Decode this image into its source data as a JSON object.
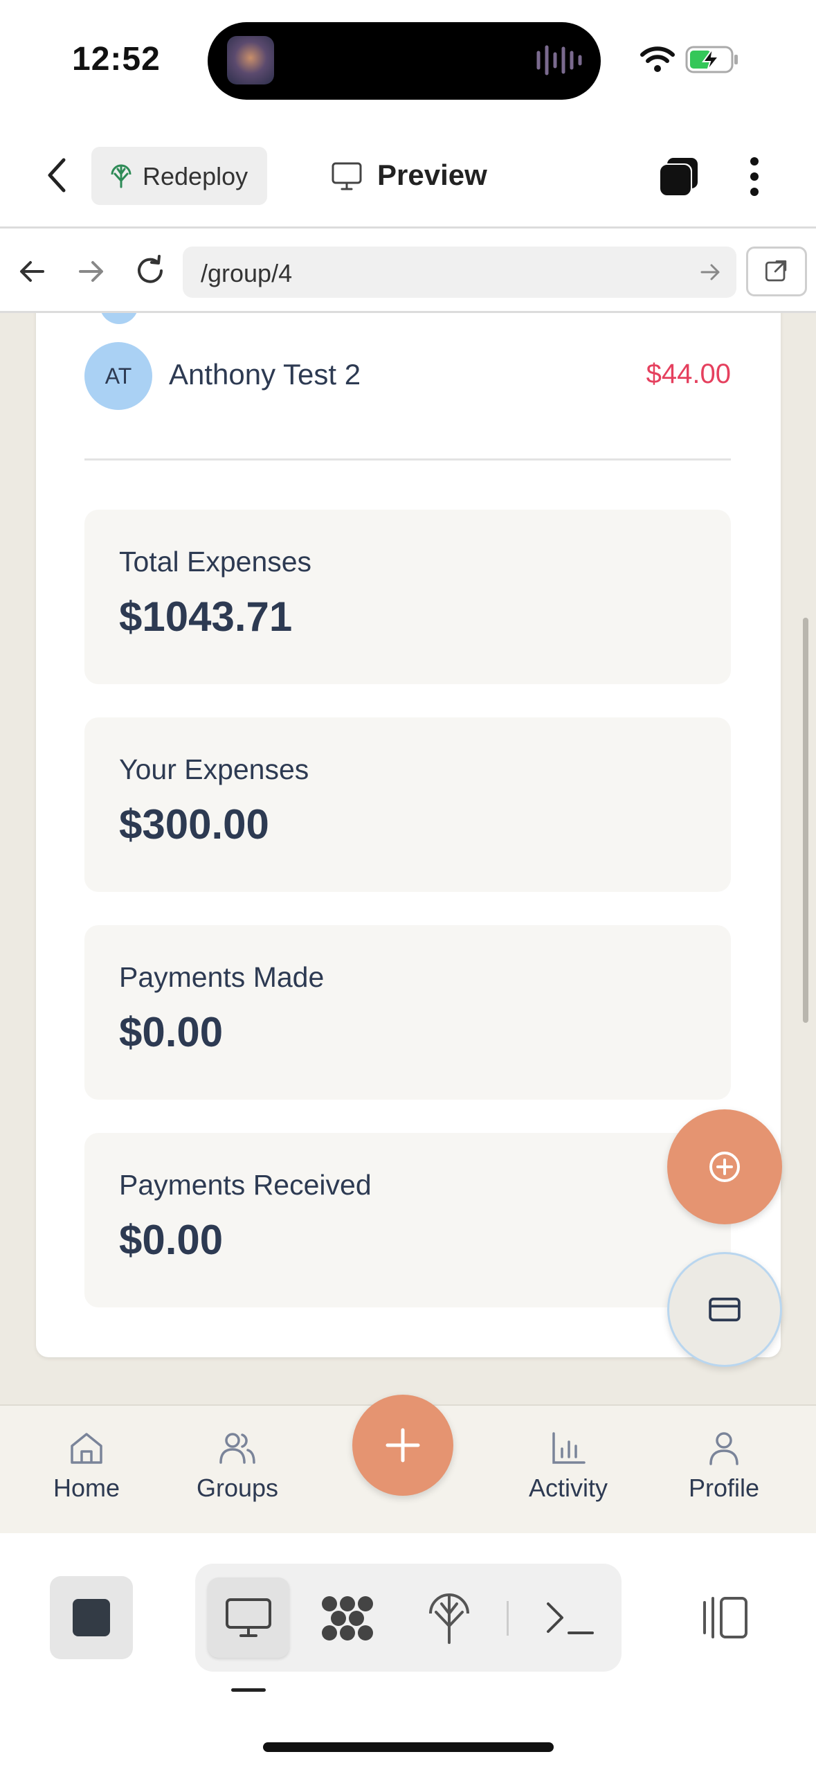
{
  "status_bar": {
    "time": "12:52"
  },
  "toolbar": {
    "redeploy_label": "Redeploy",
    "preview_label": "Preview"
  },
  "browser": {
    "url": "/group/4"
  },
  "member": {
    "initials": "AT",
    "name": "Anthony Test 2",
    "amount": "$44.00",
    "amount_color": "#e5405e"
  },
  "stats": [
    {
      "label": "Total Expenses",
      "value": "$1043.71"
    },
    {
      "label": "Your Expenses",
      "value": "$300.00"
    },
    {
      "label": "Payments Made",
      "value": "$0.00"
    },
    {
      "label": "Payments Received",
      "value": "$0.00"
    }
  ],
  "fabs": {
    "add_icon": "plus-circle-icon",
    "payment_icon": "credit-card-icon"
  },
  "tab_bar": {
    "tabs": [
      {
        "label": "Home",
        "icon": "home-icon"
      },
      {
        "label": "Groups",
        "icon": "users-icon"
      },
      {
        "label": "Activity",
        "icon": "bar-chart-icon"
      },
      {
        "label": "Profile",
        "icon": "user-icon"
      }
    ],
    "center_icon": "plus-icon"
  },
  "colors": {
    "accent": "#e59471",
    "page_bg": "#edeae2",
    "text": "#2d3a52",
    "negative": "#e5405e"
  }
}
